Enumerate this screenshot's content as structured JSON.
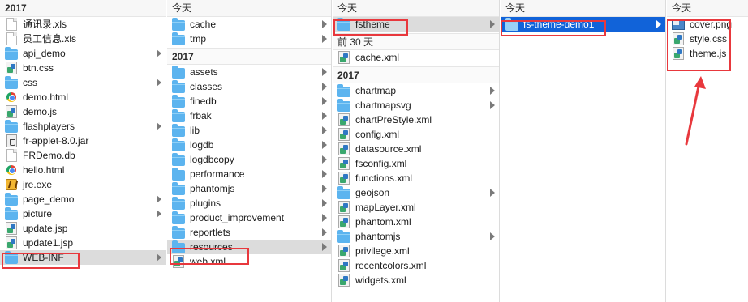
{
  "colors": {
    "selection_gray": "#dcdcdc",
    "selection_blue": "#1163d9",
    "folder": "#5cb4ef",
    "highlight_box": "#e8383d",
    "annotation_arrow": "#e8383d"
  },
  "col0": {
    "header": "2017",
    "items": [
      {
        "label": "通讯录.xls",
        "icon": "document-icon"
      },
      {
        "label": "员工信息.xls",
        "icon": "document-icon"
      },
      {
        "label": "api_demo",
        "icon": "folder-icon",
        "folder": true
      },
      {
        "label": "btn.css",
        "icon": "css-file-icon"
      },
      {
        "label": "css",
        "icon": "folder-icon",
        "folder": true
      },
      {
        "label": "demo.html",
        "icon": "chrome-icon"
      },
      {
        "label": "demo.js",
        "icon": "js-file-icon"
      },
      {
        "label": "flashplayers",
        "icon": "folder-icon",
        "folder": true
      },
      {
        "label": "fr-applet-8.0.jar",
        "icon": "jar-file-icon"
      },
      {
        "label": "FRDemo.db",
        "icon": "document-icon"
      },
      {
        "label": "hello.html",
        "icon": "chrome-icon"
      },
      {
        "label": "jre.exe",
        "icon": "exe-file-icon"
      },
      {
        "label": "page_demo",
        "icon": "folder-icon",
        "folder": true
      },
      {
        "label": "picture",
        "icon": "folder-icon",
        "folder": true
      },
      {
        "label": "update.jsp",
        "icon": "jsp-file-icon"
      },
      {
        "label": "update1.jsp",
        "icon": "jsp-file-icon"
      },
      {
        "label": "WEB-INF",
        "icon": "folder-icon",
        "folder": true,
        "selected": true
      }
    ]
  },
  "col1": {
    "header_today": "今天",
    "today_items": [
      {
        "label": "cache",
        "icon": "folder-icon",
        "folder": true
      },
      {
        "label": "tmp",
        "icon": "folder-icon",
        "folder": true
      }
    ],
    "header_2017": "2017",
    "items_2017": [
      {
        "label": "assets",
        "icon": "folder-icon",
        "folder": true
      },
      {
        "label": "classes",
        "icon": "folder-icon",
        "folder": true
      },
      {
        "label": "finedb",
        "icon": "folder-icon",
        "folder": true
      },
      {
        "label": "frbak",
        "icon": "folder-icon",
        "folder": true
      },
      {
        "label": "lib",
        "icon": "folder-icon",
        "folder": true
      },
      {
        "label": "logdb",
        "icon": "folder-icon",
        "folder": true
      },
      {
        "label": "logdbcopy",
        "icon": "folder-icon",
        "folder": true
      },
      {
        "label": "performance",
        "icon": "folder-icon",
        "folder": true
      },
      {
        "label": "phantomjs",
        "icon": "folder-icon",
        "folder": true
      },
      {
        "label": "plugins",
        "icon": "folder-icon",
        "folder": true
      },
      {
        "label": "product_improvement",
        "icon": "folder-icon",
        "folder": true
      },
      {
        "label": "reportlets",
        "icon": "folder-icon",
        "folder": true
      },
      {
        "label": "resources",
        "icon": "folder-icon",
        "folder": true,
        "selected": true
      },
      {
        "label": "web.xml",
        "icon": "xml-file-icon"
      }
    ]
  },
  "col2": {
    "header_today": "今天",
    "today_items": [
      {
        "label": "fstheme",
        "icon": "folder-icon",
        "folder": true,
        "selected": true
      }
    ],
    "header_30days": "前 30 天",
    "items_30days": [
      {
        "label": "cache.xml",
        "icon": "xml-file-icon"
      }
    ],
    "header_2017": "2017",
    "items_2017": [
      {
        "label": "chartmap",
        "icon": "folder-icon",
        "folder": true
      },
      {
        "label": "chartmapsvg",
        "icon": "folder-icon",
        "folder": true
      },
      {
        "label": "chartPreStyle.xml",
        "icon": "xml-file-icon"
      },
      {
        "label": "config.xml",
        "icon": "xml-file-icon"
      },
      {
        "label": "datasource.xml",
        "icon": "xml-file-icon"
      },
      {
        "label": "fsconfig.xml",
        "icon": "xml-file-icon"
      },
      {
        "label": "functions.xml",
        "icon": "xml-file-icon"
      },
      {
        "label": "geojson",
        "icon": "folder-icon",
        "folder": true
      },
      {
        "label": "mapLayer.xml",
        "icon": "xml-file-icon"
      },
      {
        "label": "phantom.xml",
        "icon": "xml-file-icon"
      },
      {
        "label": "phantomjs",
        "icon": "folder-icon",
        "folder": true
      },
      {
        "label": "privilege.xml",
        "icon": "xml-file-icon"
      },
      {
        "label": "recentcolors.xml",
        "icon": "xml-file-icon"
      },
      {
        "label": "widgets.xml",
        "icon": "xml-file-icon"
      }
    ]
  },
  "col3": {
    "header_today": "今天",
    "items": [
      {
        "label": "fs-theme-demo1",
        "icon": "folder-icon",
        "folder": true,
        "active": true
      }
    ]
  },
  "col4": {
    "header_today": "今天",
    "items": [
      {
        "label": "cover.png",
        "icon": "image-file-icon"
      },
      {
        "label": "style.css",
        "icon": "css-file-icon"
      },
      {
        "label": "theme.js",
        "icon": "js-file-icon"
      }
    ]
  }
}
